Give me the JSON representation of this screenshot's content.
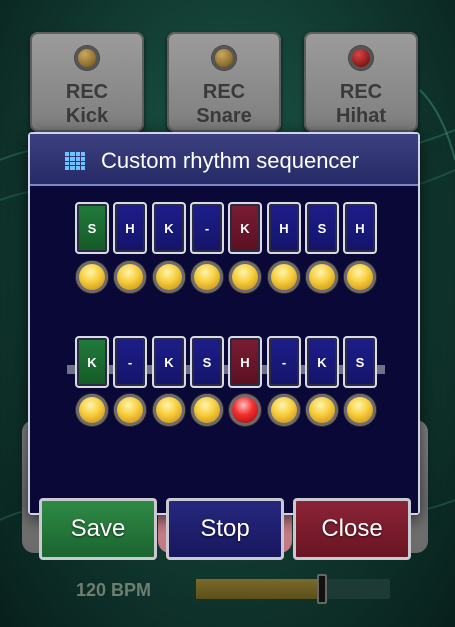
{
  "rec_buttons": [
    {
      "label": "REC\nKick",
      "led": "amber"
    },
    {
      "label": "REC\nSnare",
      "led": "amber"
    },
    {
      "label": "REC\nHihat",
      "led": "red"
    }
  ],
  "bpm": {
    "label": "120 BPM",
    "level": 0.65
  },
  "dialog": {
    "title": "Custom rhythm sequencer",
    "icon": "grid-icon",
    "pattern_top": [
      {
        "label": "S",
        "color": "green",
        "led": "amber"
      },
      {
        "label": "H",
        "color": "blue",
        "led": "amber"
      },
      {
        "label": "K",
        "color": "blue",
        "led": "amber"
      },
      {
        "label": "-",
        "color": "blue",
        "led": "amber"
      },
      {
        "label": "K",
        "color": "maroon",
        "led": "amber"
      },
      {
        "label": "H",
        "color": "blue",
        "led": "amber"
      },
      {
        "label": "S",
        "color": "blue",
        "led": "amber"
      },
      {
        "label": "H",
        "color": "blue",
        "led": "amber"
      }
    ],
    "pattern_bottom": [
      {
        "label": "K",
        "color": "green",
        "led": "amber"
      },
      {
        "label": "-",
        "color": "blue",
        "led": "amber"
      },
      {
        "label": "K",
        "color": "blue",
        "led": "amber"
      },
      {
        "label": "S",
        "color": "blue",
        "led": "amber"
      },
      {
        "label": "H",
        "color": "maroon",
        "led": "red"
      },
      {
        "label": "-",
        "color": "blue",
        "led": "amber"
      },
      {
        "label": "K",
        "color": "blue",
        "led": "amber"
      },
      {
        "label": "S",
        "color": "blue",
        "led": "amber"
      }
    ],
    "buttons": {
      "save": "Save",
      "stop": "Stop",
      "close": "Close"
    }
  },
  "colors": {
    "background": "#113a31",
    "dialog_bg": "#0a0836",
    "title_bar": "#262a66",
    "step_blue": "#1d1d8a",
    "step_green": "#237a3c",
    "step_maroon": "#7a1c34",
    "save": "#2f8a44",
    "stop": "#27277e",
    "close": "#8a2436"
  }
}
